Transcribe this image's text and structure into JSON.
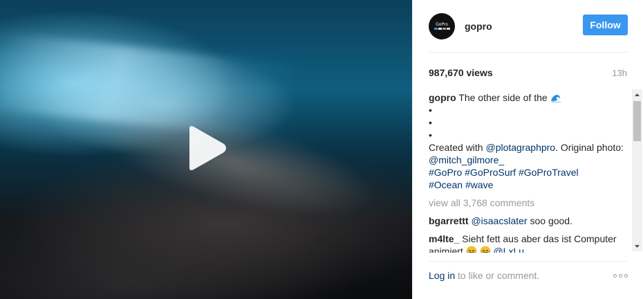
{
  "post": {
    "username": "gopro",
    "follow_label": "Follow",
    "views": "987,670 views",
    "time": "13h",
    "avatar_text": "GoPro"
  },
  "caption": {
    "user": "gopro",
    "text": "The other side of the",
    "bullets": [
      "•",
      "•",
      "•"
    ],
    "created_prefix": "Created with",
    "mention1": "@plotagraphpro",
    "original_text": ". Original photo:",
    "mention2": "@mitch_gilmore_",
    "tags": [
      "#GoPro",
      "#GoProSurf",
      "#GoProTravel",
      "#Ocean",
      "#wave"
    ]
  },
  "comments": {
    "view_all": "view all 3,768 comments",
    "items": [
      {
        "user": "bgarrettt",
        "mention": "@isaacslater",
        "text": "soo good."
      },
      {
        "user": "m4lte_",
        "text": "Sieht fett aus aber das ist Computer animiert",
        "mention": "@LxLu"
      }
    ]
  },
  "footer": {
    "login": "Log in",
    "suffix": "to like or comment."
  },
  "icons": {
    "play": "play-icon",
    "wave": "wave-emoji",
    "more": "more-options-icon",
    "scroll_up": "chevron-up-icon",
    "scroll_down": "chevron-down-icon"
  },
  "colors": {
    "accent": "#3897f0",
    "link": "#003569",
    "muted": "#999999"
  }
}
